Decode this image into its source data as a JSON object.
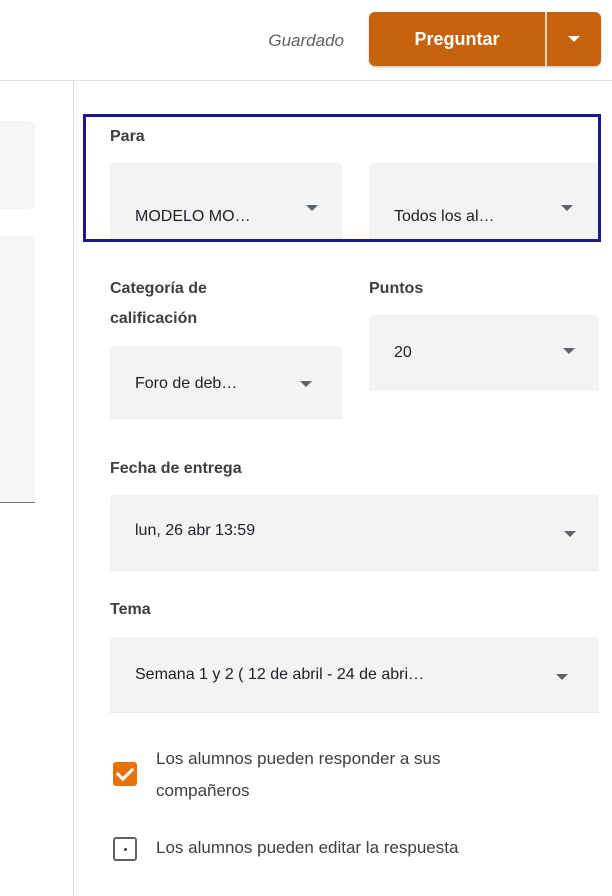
{
  "header": {
    "saved_status": "Guardado",
    "ask_button_label": "Preguntar",
    "accent_color": "#c5620b"
  },
  "assign_to": {
    "label": "Para",
    "class_select": {
      "value": "MODELO MO…"
    },
    "students_select": {
      "value": "Todos los al…"
    }
  },
  "grade_category": {
    "label_line1": "Categoría de",
    "label_line2": "calificación",
    "value": "Foro de deb…"
  },
  "points": {
    "label": "Puntos",
    "value": "20"
  },
  "due_date": {
    "label": "Fecha de entrega",
    "value": "lun, 26 abr 13:59"
  },
  "topic": {
    "label": "Tema",
    "value": "Semana 1 y 2 ( 12 de abril - 24 de abri…"
  },
  "options": {
    "reply_to_classmates": {
      "line1": "Los alumnos pueden responder a sus",
      "line2": "compañeros",
      "checked": true
    },
    "edit_answer": {
      "label": "Los alumnos pueden editar la respuesta",
      "checked": false
    },
    "checkbox_color": "#e8710a"
  }
}
